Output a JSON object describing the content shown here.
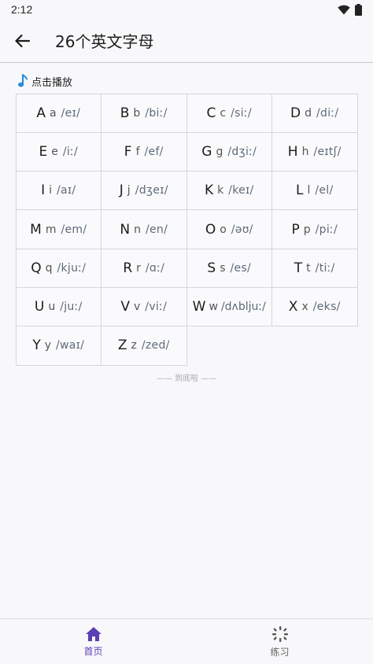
{
  "status_bar": {
    "time": "2:12"
  },
  "app_bar": {
    "title": "26个英文字母"
  },
  "hint": {
    "text": "点击播放"
  },
  "letters": [
    {
      "upper": "A",
      "lower": "a",
      "ipa": "/eɪ/"
    },
    {
      "upper": "B",
      "lower": "b",
      "ipa": "/biː/"
    },
    {
      "upper": "C",
      "lower": "c",
      "ipa": "/siː/"
    },
    {
      "upper": "D",
      "lower": "d",
      "ipa": "/diː/"
    },
    {
      "upper": "E",
      "lower": "e",
      "ipa": "/iː/"
    },
    {
      "upper": "F",
      "lower": "f",
      "ipa": "/ef/"
    },
    {
      "upper": "G",
      "lower": "g",
      "ipa": "/dʒiː/"
    },
    {
      "upper": "H",
      "lower": "h",
      "ipa": "/eɪtʃ/"
    },
    {
      "upper": "I",
      "lower": "i",
      "ipa": "/aɪ/"
    },
    {
      "upper": "J",
      "lower": "j",
      "ipa": "/dʒeɪ/"
    },
    {
      "upper": "K",
      "lower": "k",
      "ipa": "/keɪ/"
    },
    {
      "upper": "L",
      "lower": "l",
      "ipa": "/el/"
    },
    {
      "upper": "M",
      "lower": "m",
      "ipa": "/em/"
    },
    {
      "upper": "N",
      "lower": "n",
      "ipa": "/en/"
    },
    {
      "upper": "O",
      "lower": "o",
      "ipa": "/əʊ/"
    },
    {
      "upper": "P",
      "lower": "p",
      "ipa": "/piː/"
    },
    {
      "upper": "Q",
      "lower": "q",
      "ipa": "/kjuː/"
    },
    {
      "upper": "R",
      "lower": "r",
      "ipa": "/ɑː/"
    },
    {
      "upper": "S",
      "lower": "s",
      "ipa": "/es/"
    },
    {
      "upper": "T",
      "lower": "t",
      "ipa": "/tiː/"
    },
    {
      "upper": "U",
      "lower": "u",
      "ipa": "/juː/"
    },
    {
      "upper": "V",
      "lower": "v",
      "ipa": "/viː/"
    },
    {
      "upper": "W",
      "lower": "w",
      "ipa": "/dʌbljuː/"
    },
    {
      "upper": "X",
      "lower": "x",
      "ipa": "/eks/"
    },
    {
      "upper": "Y",
      "lower": "y",
      "ipa": "/waɪ/"
    },
    {
      "upper": "Z",
      "lower": "z",
      "ipa": "/zed/"
    }
  ],
  "end_note": "—— 到底啦 ——",
  "bottom_nav": {
    "items": [
      {
        "label": "首页",
        "icon": "home-icon",
        "active": true
      },
      {
        "label": "练习",
        "icon": "practice-icon",
        "active": false
      }
    ]
  },
  "colors": {
    "accent": "#5b3fb5",
    "music_icon": "#2a8fd8",
    "grid_border": "#d6d6d9"
  }
}
